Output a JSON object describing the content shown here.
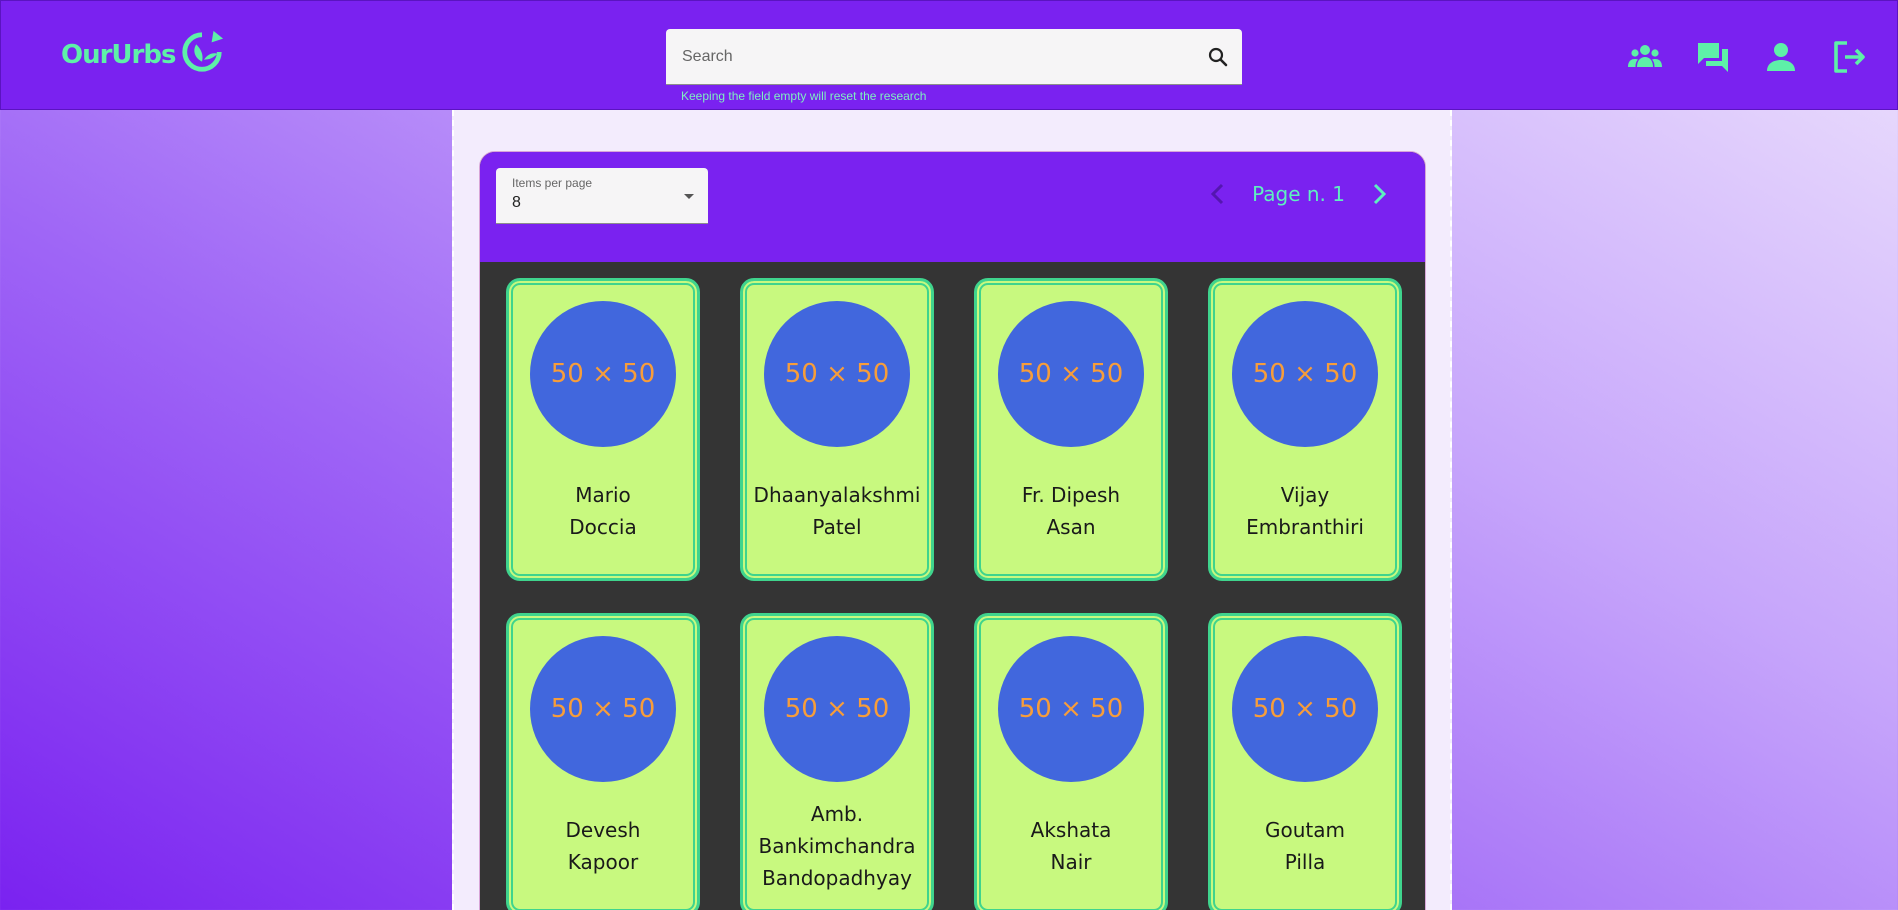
{
  "header": {
    "logo_text": "OurUrbs",
    "search": {
      "placeholder": "Search",
      "value": ""
    },
    "search_hint": "Keeping the field empty will reset the research",
    "nav_icons": [
      "groups-icon",
      "chat-icon",
      "person-icon",
      "logout-icon"
    ]
  },
  "pagination": {
    "items_per_page_label": "Items per page",
    "items_per_page_value": "8",
    "page_label": "Page n. 1"
  },
  "avatar_placeholder": "50 × 50",
  "users": [
    {
      "name_lines": [
        "Mario",
        "Doccia"
      ]
    },
    {
      "name_lines": [
        "Dhaanyalakshmi",
        "Patel"
      ]
    },
    {
      "name_lines": [
        "Fr. Dipesh",
        "Asan"
      ]
    },
    {
      "name_lines": [
        "Vijay",
        "Embranthiri"
      ]
    },
    {
      "name_lines": [
        "Devesh",
        "Kapoor"
      ]
    },
    {
      "name_lines": [
        "Amb.",
        "Bankimchandra",
        "Bandopadhyay"
      ]
    },
    {
      "name_lines": [
        "Akshata",
        "Nair"
      ]
    },
    {
      "name_lines": [
        "Goutam",
        "Pilla"
      ]
    }
  ],
  "colors": {
    "primary": "#7a22f0",
    "accent": "#5ef0a8",
    "card_bg": "#c8f97f",
    "avatar_bg": "#4167dd",
    "avatar_text": "#f79d3a"
  }
}
